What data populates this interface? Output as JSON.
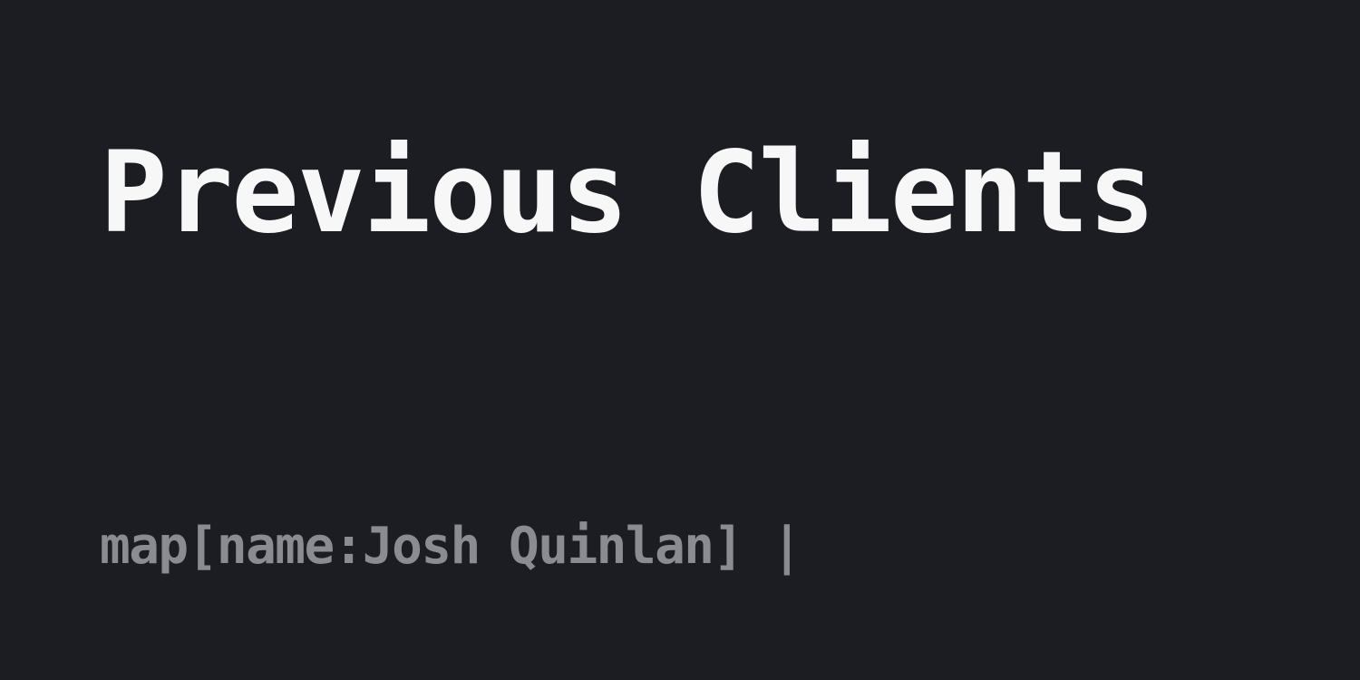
{
  "card": {
    "title": "Previous Clients",
    "subtitle": "map[name:Josh Quinlan] |"
  },
  "colors": {
    "background": "#1c1d22",
    "title": "#f7f7f7",
    "subtitle": "#8b8c92"
  }
}
